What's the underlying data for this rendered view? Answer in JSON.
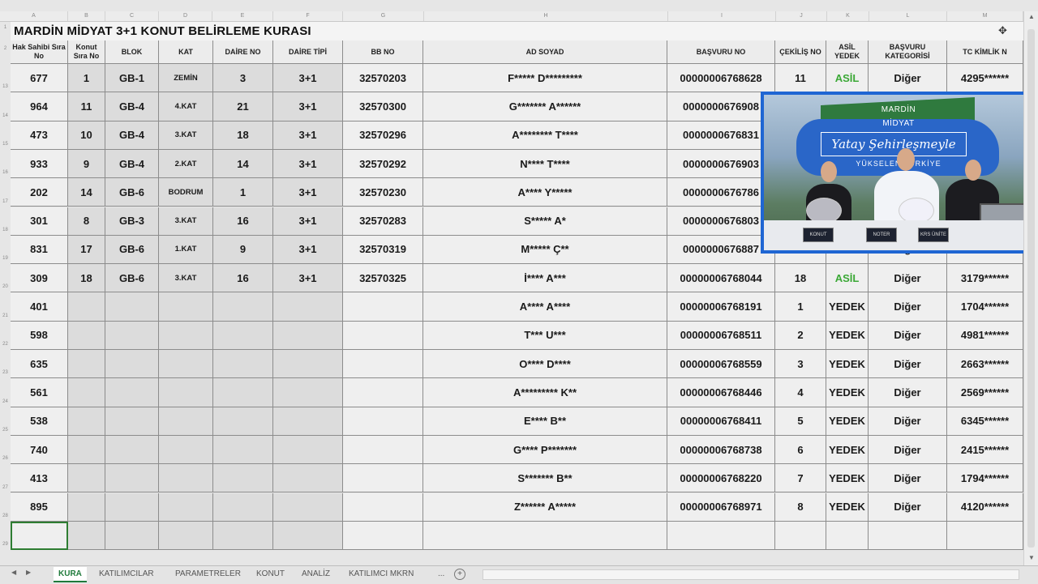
{
  "title": "MARDİN MİDYAT 3+1 KONUT BELİRLEME KURASI",
  "column_letters": [
    "A",
    "B",
    "C",
    "D",
    "E",
    "F",
    "G",
    "H",
    "I",
    "J",
    "K",
    "L",
    "M"
  ],
  "row_numbers": [
    "1",
    "2",
    "13",
    "14",
    "15",
    "16",
    "17",
    "18",
    "19",
    "20",
    "21",
    "22",
    "23",
    "24",
    "25",
    "26",
    "27",
    "28",
    "29"
  ],
  "headers": {
    "hak_sahibi": "Hak Sahibi Sıra No",
    "konut_sira": "Konut Sıra No",
    "blok": "BLOK",
    "kat": "KAT",
    "daire_no": "DAİRE NO",
    "daire_tipi": "DAİRE TİPİ",
    "bb_no": "BB NO",
    "ad_soyad": "AD SOYAD",
    "basvuru_no": "BAŞVURU NO",
    "cekilis_no": "ÇEKİLİŞ NO",
    "asil_yedek": "ASİL YEDEK",
    "basvuru_kat": "BAŞVURU KATEGORİSİ",
    "tc": "TC KİMLİK N"
  },
  "rows": [
    {
      "hak": "677",
      "konut": "1",
      "blok": "GB-1",
      "kat": "ZEMİN",
      "daire": "3",
      "tip": "3+1",
      "bb": "32570203",
      "ad": "F***** D*********",
      "basvuru": "00000006768628",
      "cekilis": "11",
      "asil": "ASİL",
      "kategori": "Diğer",
      "tc": "4295******"
    },
    {
      "hak": "964",
      "konut": "11",
      "blok": "GB-4",
      "kat": "4.KAT",
      "daire": "21",
      "tip": "3+1",
      "bb": "32570300",
      "ad": "G******* A******",
      "basvuru": "0000000676908",
      "cekilis": "",
      "asil": "",
      "kategori": "",
      "tc": ""
    },
    {
      "hak": "473",
      "konut": "10",
      "blok": "GB-4",
      "kat": "3.KAT",
      "daire": "18",
      "tip": "3+1",
      "bb": "32570296",
      "ad": "A******** T****",
      "basvuru": "0000000676831",
      "cekilis": "",
      "asil": "",
      "kategori": "",
      "tc": ""
    },
    {
      "hak": "933",
      "konut": "9",
      "blok": "GB-4",
      "kat": "2.KAT",
      "daire": "14",
      "tip": "3+1",
      "bb": "32570292",
      "ad": "N**** T****",
      "basvuru": "0000000676903",
      "cekilis": "",
      "asil": "",
      "kategori": "",
      "tc": ""
    },
    {
      "hak": "202",
      "konut": "14",
      "blok": "GB-6",
      "kat": "BODRUM",
      "daire": "1",
      "tip": "3+1",
      "bb": "32570230",
      "ad": "A**** Y*****",
      "basvuru": "0000000676786",
      "cekilis": "",
      "asil": "",
      "kategori": "",
      "tc": ""
    },
    {
      "hak": "301",
      "konut": "8",
      "blok": "GB-3",
      "kat": "3.KAT",
      "daire": "16",
      "tip": "3+1",
      "bb": "32570283",
      "ad": "S***** A*",
      "basvuru": "0000000676803",
      "cekilis": "",
      "asil": "",
      "kategori": "",
      "tc": ""
    },
    {
      "hak": "831",
      "konut": "17",
      "blok": "GB-6",
      "kat": "1.KAT",
      "daire": "9",
      "tip": "3+1",
      "bb": "32570319",
      "ad": "M***** Ç**",
      "basvuru": "0000000676887",
      "cekilis": "",
      "asil": "",
      "kategori": "Diğer",
      "tc": ""
    },
    {
      "hak": "309",
      "konut": "18",
      "blok": "GB-6",
      "kat": "3.KAT",
      "daire": "16",
      "tip": "3+1",
      "bb": "32570325",
      "ad": "İ**** A***",
      "basvuru": "00000006768044",
      "cekilis": "18",
      "asil": "ASİL",
      "kategori": "Diğer",
      "tc": "3179******"
    },
    {
      "hak": "401",
      "konut": "",
      "blok": "",
      "kat": "",
      "daire": "",
      "tip": "",
      "bb": "",
      "ad": "A**** A****",
      "basvuru": "00000006768191",
      "cekilis": "1",
      "asil": "YEDEK",
      "kategori": "Diğer",
      "tc": "1704******"
    },
    {
      "hak": "598",
      "konut": "",
      "blok": "",
      "kat": "",
      "daire": "",
      "tip": "",
      "bb": "",
      "ad": "T*** U***",
      "basvuru": "00000006768511",
      "cekilis": "2",
      "asil": "YEDEK",
      "kategori": "Diğer",
      "tc": "4981******"
    },
    {
      "hak": "635",
      "konut": "",
      "blok": "",
      "kat": "",
      "daire": "",
      "tip": "",
      "bb": "",
      "ad": "O**** D****",
      "basvuru": "00000006768559",
      "cekilis": "3",
      "asil": "YEDEK",
      "kategori": "Diğer",
      "tc": "2663******"
    },
    {
      "hak": "561",
      "konut": "",
      "blok": "",
      "kat": "",
      "daire": "",
      "tip": "",
      "bb": "",
      "ad": "A********* K**",
      "basvuru": "00000006768446",
      "cekilis": "4",
      "asil": "YEDEK",
      "kategori": "Diğer",
      "tc": "2569******"
    },
    {
      "hak": "538",
      "konut": "",
      "blok": "",
      "kat": "",
      "daire": "",
      "tip": "",
      "bb": "",
      "ad": "E**** B**",
      "basvuru": "00000006768411",
      "cekilis": "5",
      "asil": "YEDEK",
      "kategori": "Diğer",
      "tc": "6345******"
    },
    {
      "hak": "740",
      "konut": "",
      "blok": "",
      "kat": "",
      "daire": "",
      "tip": "",
      "bb": "",
      "ad": "G**** P*******",
      "basvuru": "00000006768738",
      "cekilis": "6",
      "asil": "YEDEK",
      "kategori": "Diğer",
      "tc": "2415******"
    },
    {
      "hak": "413",
      "konut": "",
      "blok": "",
      "kat": "",
      "daire": "",
      "tip": "",
      "bb": "",
      "ad": "S******* B**",
      "basvuru": "00000006768220",
      "cekilis": "7",
      "asil": "YEDEK",
      "kategori": "Diğer",
      "tc": "1794******"
    },
    {
      "hak": "895",
      "konut": "",
      "blok": "",
      "kat": "",
      "daire": "",
      "tip": "",
      "bb": "",
      "ad": "Z****** A*****",
      "basvuru": "00000006768971",
      "cekilis": "8",
      "asil": "YEDEK",
      "kategori": "Diğer",
      "tc": "4120******"
    }
  ],
  "video": {
    "line1": "MARDİN",
    "line2": "MİDYAT",
    "slogan": "Yatay Şehirleşmeyle",
    "sub": "YÜKSELEN TÜRKİYE",
    "tag_left": "KONUT",
    "tag_mid": "NOTER",
    "tag_right": "KRS ÜNİTE"
  },
  "sheet_tabs": [
    "KURA",
    "KATILIMCILAR",
    "PARAMETRELER",
    "KONUT",
    "ANALİZ",
    "KATILIMCI MKRN"
  ],
  "active_tab": "KURA",
  "tab_more": "...",
  "tab_add": "+",
  "colors": {
    "asil_green": "#3aa835",
    "tab_green": "#1f7a3b",
    "video_blue": "#1f66d3"
  }
}
